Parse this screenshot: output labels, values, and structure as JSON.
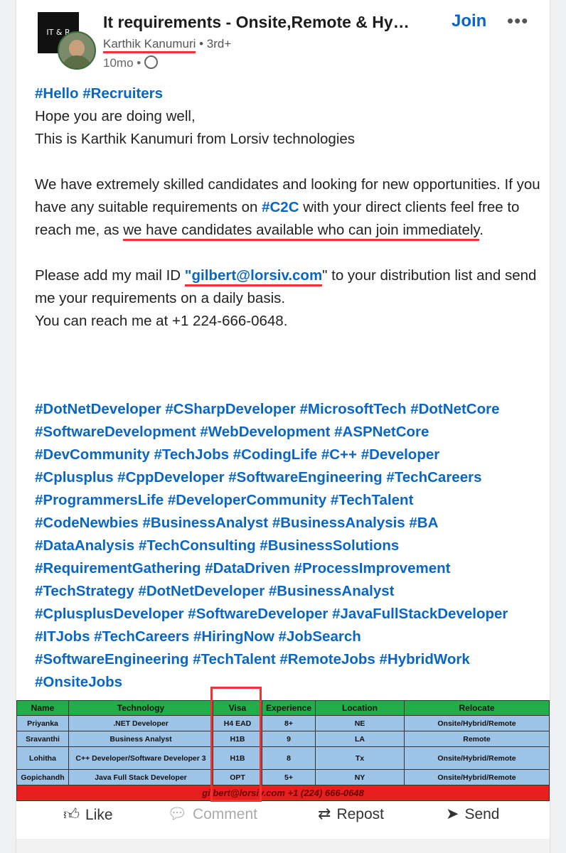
{
  "group": {
    "logo_text": "IT & R",
    "title": "It requirements - Onsite,Remote & Hy…",
    "join_label": "Join",
    "more_label": "•••"
  },
  "author": {
    "name": "Karthik Kanumuri",
    "degree": "• 3rd+",
    "time": "10mo •"
  },
  "post": {
    "hashtags_line1": "#Hello #Recruiters",
    "greeting": "Hope you are doing well,",
    "intro": "This is Karthik Kanumuri from Lorsiv technologies",
    "para1_a": "We have extremely skilled candidates and looking for new opportunities. If you have any suitable requirements on",
    "para1_tag": "#C2C",
    "para1_b": "with your direct clients feel free to reach me, as",
    "para1_highlight": "we have candidates available who can join immediately",
    "para1_end": ".",
    "para2_a": "Please add my mail ID",
    "email": "\"gilbert@lorsiv.com",
    "para2_b": "\" to your distribution list and send me your requirements on a daily basis.",
    "phone_line": "You can reach me at +1 224-666-0648.",
    "hashtags": [
      "#DotNetDeveloper #CSharpDeveloper #MicrosoftTech #DotNetCore",
      " #SoftwareDevelopment #WebDevelopment #ASPNetCore",
      " #DevCommunity #TechJobs #CodingLife #C++ #Developer",
      " #Cplusplus #CppDeveloper #SoftwareEngineering #TechCareers",
      " #ProgrammersLife #DeveloperCommunity #TechTalent",
      " #CodeNewbies #BusinessAnalyst #BusinessAnalysis #BA",
      " #DataAnalysis #TechConsulting #BusinessSolutions",
      " #RequirementGathering #DataDriven #ProcessImprovement",
      " #TechStrategy #DotNetDeveloper #BusinessAnalyst",
      " #CplusplusDeveloper #SoftwareDeveloper #JavaFullStackDeveloper",
      " #ITJobs #TechCareers #HiringNow #JobSearch",
      " #SoftwareEngineering #TechTalent #RemoteJobs #HybridWork",
      " #OnsiteJobs"
    ]
  },
  "table": {
    "headers": [
      "Name",
      "Technology",
      "Visa",
      "Experience",
      "Location",
      "Relocate"
    ],
    "rows": [
      [
        "Priyanka",
        ".NET Developer",
        "H4 EAD",
        "8+",
        "NE",
        "Onsite/Hybrid/Remote"
      ],
      [
        "Sravanthi",
        "Business Analyst",
        "H1B",
        "9",
        "LA",
        "Remote"
      ],
      [
        "Lohitha",
        "C++ Developer/Software Developer 3",
        "H1B",
        "8",
        "Tx",
        "Onsite/Hybrid/Remote"
      ],
      [
        "Gopichandh",
        "Java Full Stack Developer",
        "OPT",
        "5+",
        "NY",
        "Onsite/Hybrid/Remote"
      ]
    ],
    "footer": "gilbert@lorsiv.com  +1 (224) 666-0648"
  },
  "actions": {
    "like": "Like",
    "comment": "Comment",
    "repost": "Repost",
    "send": "Send"
  },
  "colors": {
    "link": "#0a66c2",
    "annotation_red": "#e33333",
    "table_header": "#1fae4a",
    "table_cell": "#9dc3e6",
    "table_footer": "#e81f1f"
  }
}
